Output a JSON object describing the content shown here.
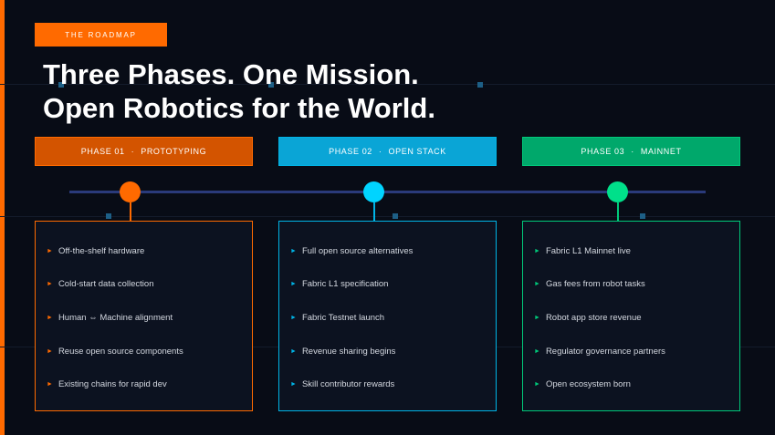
{
  "tag": "THE ROADMAP",
  "title_lines": [
    "Three Phases. One Mission.",
    "Open Robotics for the World."
  ],
  "bullet_glyph": "►",
  "colors": {
    "accent": "#ff6a00",
    "phase1": "#ff6a00",
    "phase1_header": "#d35400",
    "phase2": "#00b4e6",
    "phase2_header": "#0aa5d6",
    "phase3": "#00c97a",
    "phase3_header": "#00a86b",
    "timeline": "#2a3a7a",
    "background": "#080c16"
  },
  "phases": [
    {
      "number": "PHASE 01",
      "separator": "·",
      "name": "PROTOTYPING",
      "items": [
        "Off-the-shelf hardware",
        "Cold-start data collection",
        "Human ⇔ Machine alignment",
        "Reuse open source components",
        "Existing chains for rapid dev"
      ]
    },
    {
      "number": "PHASE 02",
      "separator": "·",
      "name": "OPEN STACK",
      "items": [
        "Full open source alternatives",
        "Fabric L1 specification",
        "Fabric Testnet launch",
        "Revenue sharing begins",
        "Skill contributor rewards"
      ]
    },
    {
      "number": "PHASE 03",
      "separator": "·",
      "name": "MAINNET",
      "items": [
        "Fabric L1 Mainnet live",
        "Gas fees from robot tasks",
        "Robot app store revenue",
        "Regulator governance partners",
        "Open ecosystem born"
      ]
    }
  ]
}
